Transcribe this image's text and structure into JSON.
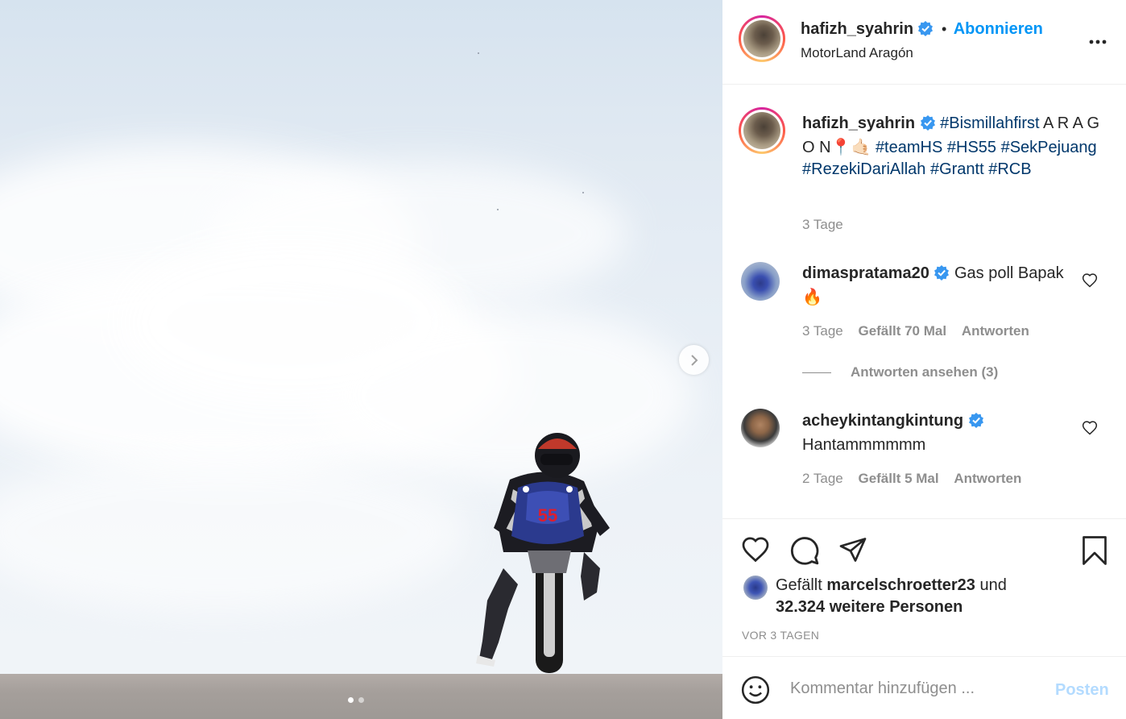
{
  "post": {
    "author": "hafizh_syahrin",
    "follow_label": "Abonnieren",
    "separator": "•",
    "location": "MotorLand Aragón",
    "caption_text_1": "A R A G O N",
    "caption_emoji": "📍🤙🏻",
    "hashtags": [
      "#Bismillahfirst",
      "#teamHS",
      "#HS55",
      "#SekPejuang",
      "#RezekiDariAllah",
      "#Grantt",
      "#RCB"
    ],
    "caption_time": "3 Tage",
    "rider_number": "55"
  },
  "comments": [
    {
      "user": "dimaspratama20",
      "text": "Gas poll Bapak🔥",
      "time": "3 Tage",
      "likes": "Gefällt 70 Mal",
      "reply": "Antworten",
      "view_replies": "Antworten ansehen (3)"
    },
    {
      "user": "acheykintangkintung",
      "text": "Hantammmmmm",
      "time": "2 Tage",
      "likes": "Gefällt 5 Mal",
      "reply": "Antworten"
    }
  ],
  "likes": {
    "prefix": "Gefällt",
    "user": "marcelschroetter23",
    "and": "und",
    "others": "32.324 weitere Personen"
  },
  "timestamp": "VOR 3 TAGEN",
  "comment_box": {
    "placeholder": "Kommentar hinzufügen ...",
    "post_label": "Posten"
  },
  "carousel": {
    "count": 2,
    "active": 1
  },
  "colors": {
    "link_blue": "#0095f6",
    "hashtag": "#00376b",
    "verified": "#3897f0",
    "muted": "#8e8e8e"
  },
  "icons": [
    "verified-icon",
    "more-icon",
    "heart-icon",
    "comment-icon",
    "share-icon",
    "bookmark-icon",
    "emoji-icon",
    "chevron-right-icon"
  ]
}
